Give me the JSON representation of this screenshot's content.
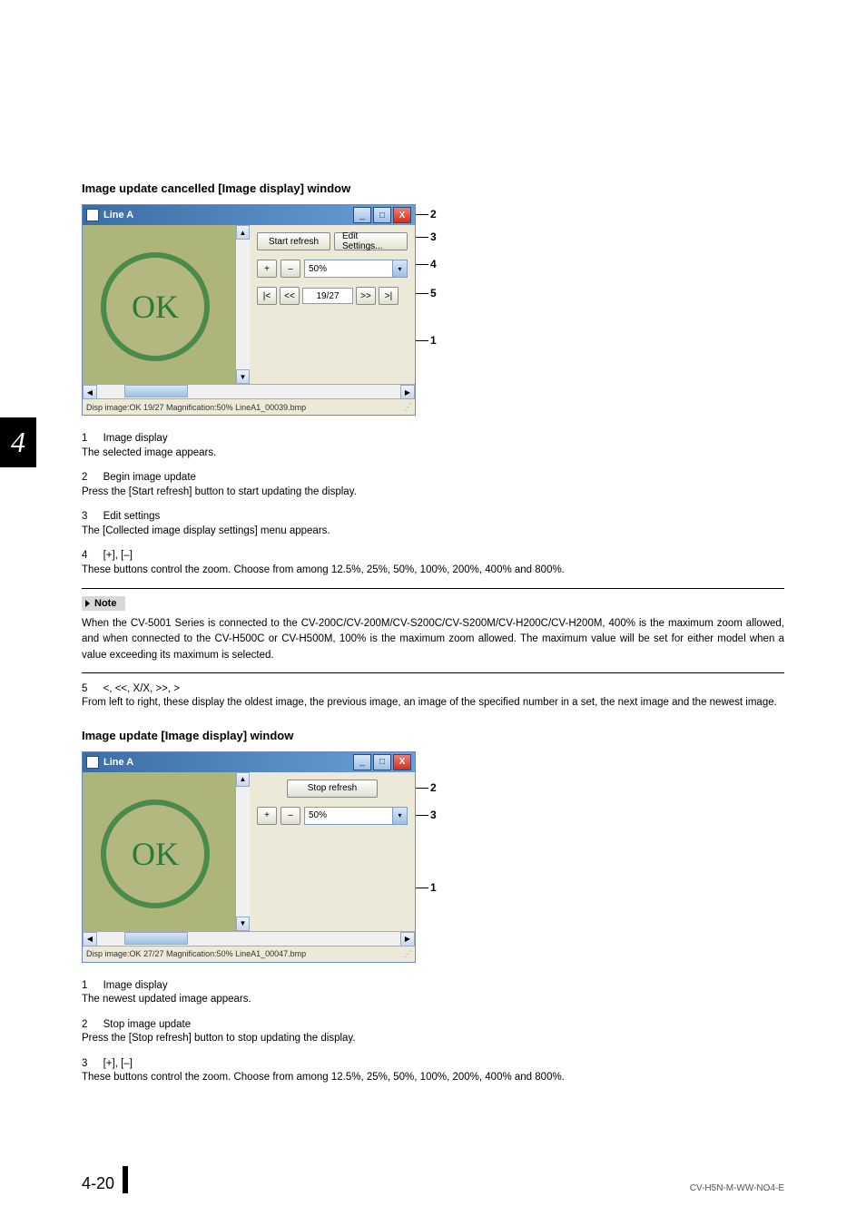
{
  "chapter_tab": "4",
  "section1": {
    "heading": "Image update cancelled [Image display] window",
    "screenshot": {
      "title": "Line A",
      "btn_refresh": "Start refresh",
      "btn_edit": "Edit Settings...",
      "zoom_value": "50%",
      "nav_counter": "19/27",
      "statusbar": "Disp image:OK 19/27 Magnification:50% LineA1_00039.bmp",
      "ok_text": "OK"
    },
    "callouts": {
      "c1": "1",
      "c2": "2",
      "c3": "3",
      "c4": "4",
      "c5": "5"
    },
    "items": {
      "i1_num": "1",
      "i1_ttl": "Image display",
      "i1_body": "The selected image appears.",
      "i2_num": "2",
      "i2_ttl": "Begin image update",
      "i2_body": "Press the [Start refresh] button to start updating the display.",
      "i3_num": "3",
      "i3_ttl": "Edit settings",
      "i3_body": "The [Collected image display settings] menu appears.",
      "i4_num": "4",
      "i4_ttl": "[+], [–]",
      "i4_body": "These buttons control the zoom. Choose from among 12.5%, 25%, 50%, 100%, 200%, 400% and 800%."
    },
    "note_label": "Note",
    "note_text": "When the CV-5001 Series is connected to the CV-200C/CV-200M/CV-S200C/CV-S200M/CV-H200C/CV-H200M, 400% is the maximum zoom allowed, and when connected to the CV-H500C or CV-H500M, 100% is the maximum zoom allowed. The maximum value will be set for either model when a value exceeding its maximum is selected.",
    "i5_num": "5",
    "i5_ttl": "<, <<, X/X, >>,  >",
    "i5_body": "From left to right, these display the oldest image, the previous image, an image of the specified number in a set, the next image and the newest image."
  },
  "section2": {
    "heading": "Image update [Image display] window",
    "screenshot": {
      "title": "Line A",
      "btn_stop": "Stop refresh",
      "zoom_value": "50%",
      "statusbar": "Disp image:OK 27/27 Magnification:50% LineA1_00047.bmp",
      "ok_text": "OK"
    },
    "callouts": {
      "c1": "1",
      "c2": "2",
      "c3": "3"
    },
    "items": {
      "i1_num": "1",
      "i1_ttl": "Image display",
      "i1_body": "The newest updated image appears.",
      "i2_num": "2",
      "i2_ttl": "Stop image update",
      "i2_body": "Press the [Stop refresh] button to stop updating the display.",
      "i3_num": "3",
      "i3_ttl": "[+], [–]",
      "i3_body": "These buttons control the zoom. Choose from among 12.5%, 25%, 50%, 100%, 200%, 400% and 800%."
    }
  },
  "footer": {
    "pagenum": "4-20",
    "doccode": "CV-H5N-M-WW-NO4-E"
  },
  "glyphs": {
    "plus": "+",
    "minus": "–",
    "first": "|<",
    "prev": "<<",
    "next": ">>",
    "last": ">|",
    "min": "_",
    "max": "□",
    "close": "X",
    "up": "▲",
    "down": "▼",
    "left": "◀",
    "right": "▶",
    "dd": "▾"
  }
}
